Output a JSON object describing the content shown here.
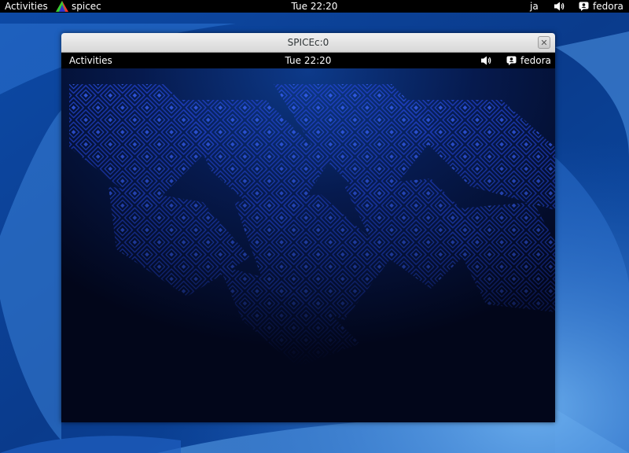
{
  "host": {
    "topbar": {
      "activities_label": "Activities",
      "app_name": "spicec",
      "clock": "Tue 22:20",
      "language": "ja",
      "username": "fedora"
    },
    "colors": {
      "wallpaper_base": "#0b3f8f",
      "wallpaper_light": "#3d86dc",
      "panel": "#000000"
    }
  },
  "window": {
    "title": "SPICEc:0",
    "close_glyph": "✕"
  },
  "guest": {
    "topbar": {
      "activities_label": "Activities",
      "clock": "Tue 22:20",
      "username": "fedora"
    },
    "colors": {
      "background_dark": "#02061a",
      "pattern_blue": "#1a3fd0"
    }
  },
  "icons": {
    "app": "spicec-app-icon",
    "volume": "volume-icon",
    "user": "user-icon",
    "close": "close-icon"
  }
}
